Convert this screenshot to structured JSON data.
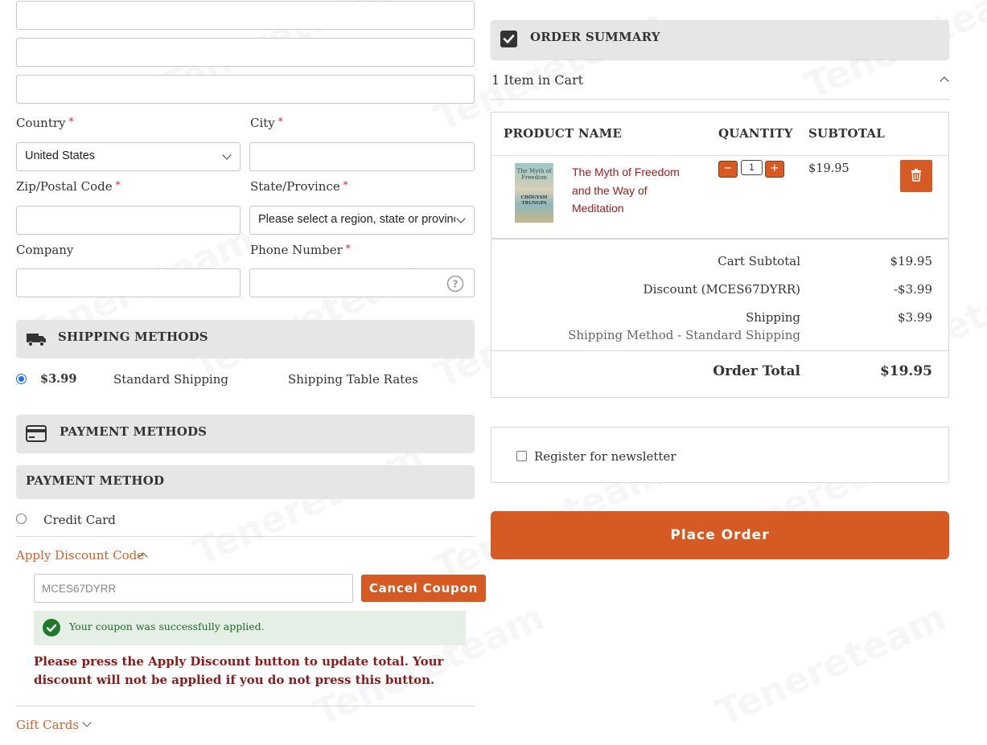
{
  "address_form": {
    "country_label": "Country",
    "country_value": "United States",
    "city_label": "City",
    "zip_label": "Zip/Postal Code",
    "state_label": "State/Province",
    "state_value": "Please select a region, state or province.",
    "company_label": "Company",
    "phone_label": "Phone Number",
    "required_mark": "*"
  },
  "shipping": {
    "title": "SHIPPING METHODS",
    "price": "$3.99",
    "method": "Standard Shipping",
    "carrier": "Shipping Table Rates"
  },
  "payment": {
    "title": "PAYMENT METHODS",
    "subtitle": "PAYMENT METHOD",
    "option": "Credit Card"
  },
  "discount": {
    "toggle_label": "Apply Discount Code",
    "code_value": "MCES67DYRR",
    "cancel_label": "Cancel Coupon",
    "success_message": "Your coupon was successfully applied.",
    "warning": "Please press the Apply Discount button to update total. Your discount will not be applied if you do not press this button."
  },
  "gift_cards": {
    "label": "Gift Cards"
  },
  "order_summary": {
    "title": "ORDER SUMMARY",
    "items_in_cart": "1 Item in Cart",
    "col_product": "PRODUCT NAME",
    "col_quantity": "QUANTITY",
    "col_subtotal": "SUBTOTAL",
    "item": {
      "name": "The Myth of Freedom and the Way of Meditation",
      "qty": "1",
      "subtotal": "$19.95",
      "book_title": "The Myth of Freedom",
      "book_author": "CHÖGYAM TRUNGPA"
    },
    "totals": {
      "cart_subtotal_label": "Cart Subtotal",
      "cart_subtotal_value": "$19.95",
      "discount_label": "Discount (MCES67DYRR)",
      "discount_value": "-$3.99",
      "shipping_label": "Shipping",
      "shipping_value": "$3.99",
      "shipping_method": "Shipping Method - Standard Shipping",
      "order_total_label": "Order Total",
      "order_total_value": "$19.95"
    }
  },
  "newsletter": {
    "label": "Register for newsletter"
  },
  "place_order": {
    "label": "Place Order"
  },
  "watermark": "Tenereteam",
  "colors": {
    "accent": "#d65a24",
    "link": "#d2622a",
    "section_bg": "#e6e6e6",
    "success_bg": "#e5efe5",
    "warning": "#8b1a1a"
  }
}
